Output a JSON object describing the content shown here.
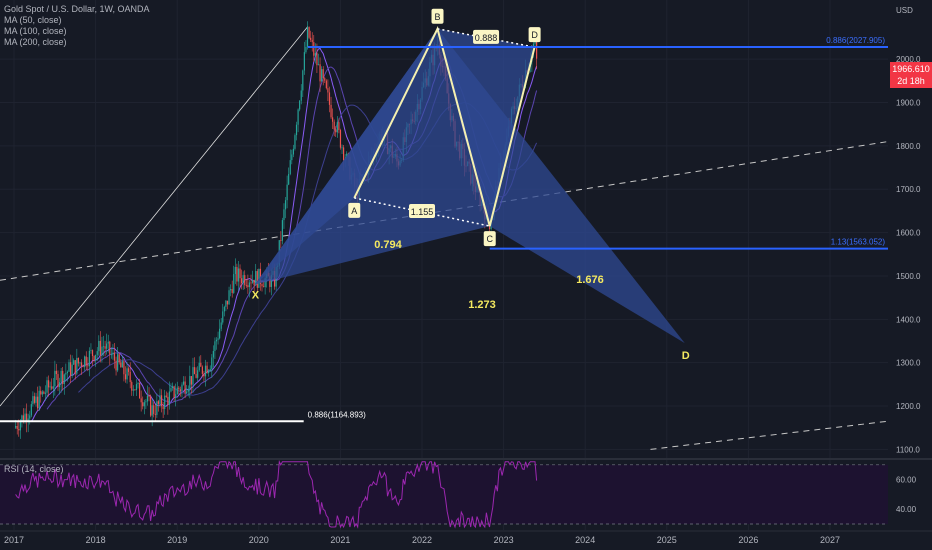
{
  "legend": {
    "title": "Gold Spot / U.S. Dollar, 1W, OANDA",
    "ma50": "MA (50, close)",
    "ma100": "MA (100, close)",
    "ma200": "MA (200, close)",
    "rsi": "RSI (14, close)"
  },
  "currency": "USD",
  "price_badge": {
    "price": "1966.610",
    "countdown": "2d 18h"
  },
  "colors": {
    "background": "#161a25",
    "up": "#26a69a",
    "down": "#ef5350",
    "pattern_fill": "#2f4a93",
    "pattern_line": "#f5f0b0",
    "fib_line": "#2962ff",
    "rsi": "#9c27b0",
    "label": "#f5e960"
  },
  "chart_data": {
    "type": "candlestick",
    "x_axis": {
      "ticks": [
        "2017",
        "2018",
        "2019",
        "2020",
        "2021",
        "2022",
        "2023",
        "2024",
        "2025",
        "2026",
        "2027"
      ]
    },
    "y_axis": {
      "ticks": [
        1100,
        1200,
        1300,
        1400,
        1500,
        1600,
        1700,
        1800,
        1900,
        2000
      ],
      "range": [
        1050,
        2080
      ],
      "unit": "USD"
    },
    "current_price": 1966.61,
    "pattern_points": [
      {
        "label": "X",
        "date": 2019.95,
        "price": 1480
      },
      {
        "label": "A",
        "date": 2021.17,
        "price": 1680
      },
      {
        "label": "B",
        "date": 2022.19,
        "price": 2070
      },
      {
        "label": "C",
        "date": 2022.83,
        "price": 1615
      },
      {
        "label": "D",
        "date": 2023.38,
        "price": 2027.9
      },
      {
        "label": "D",
        "date": 2025.22,
        "price": 1345
      }
    ],
    "ratios": [
      {
        "label": "0.888",
        "value": 0.888
      },
      {
        "label": "1.155",
        "value": 1.155
      },
      {
        "label": "0.794",
        "value": 0.794
      },
      {
        "label": "1.676",
        "value": 1.676
      },
      {
        "label": "1.273",
        "value": 1.273
      }
    ],
    "fib_levels": [
      {
        "label": "0.886(2027.905)",
        "price": 2027.905
      },
      {
        "label": "1.13(1563.052)",
        "price": 1563.052
      },
      {
        "label": "0.886(1164.893)",
        "price": 1164.893
      }
    ],
    "rsi": {
      "ticks": [
        40,
        60
      ],
      "upper": 70,
      "lower": 30
    }
  }
}
